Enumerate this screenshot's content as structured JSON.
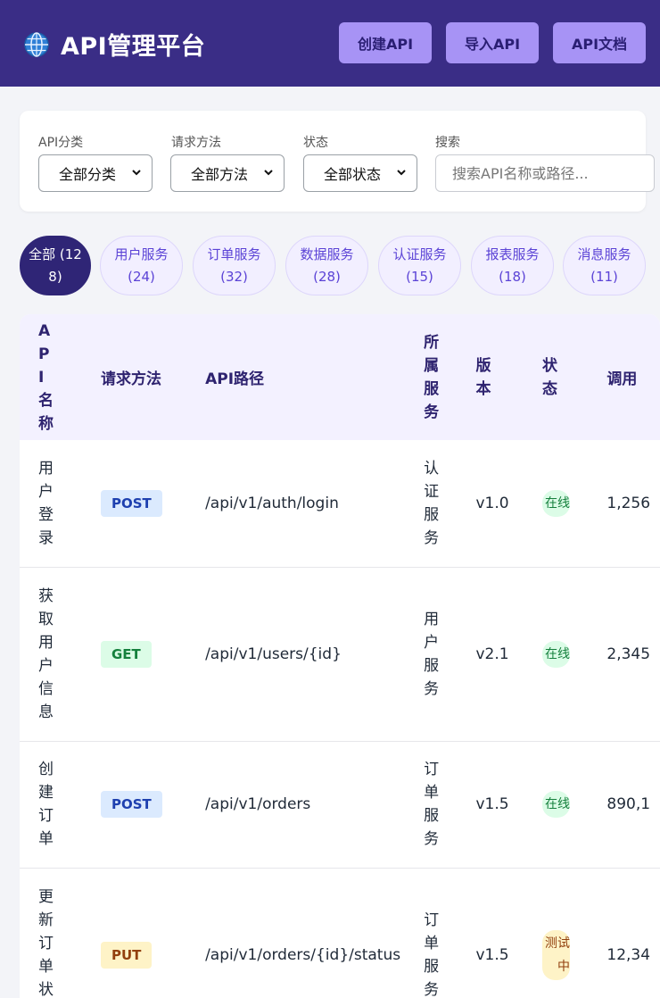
{
  "header": {
    "title": "API管理平台",
    "icon": "globe-icon",
    "buttons": [
      "创建API",
      "导入API",
      "API文档"
    ]
  },
  "filters": {
    "category": {
      "label": "API分类",
      "value": "全部分类"
    },
    "method": {
      "label": "请求方法",
      "value": "全部方法"
    },
    "status": {
      "label": "状态",
      "value": "全部状态"
    },
    "search": {
      "label": "搜索",
      "placeholder": "搜索API名称或路径..."
    }
  },
  "chips": [
    {
      "label": "全部 (128)",
      "active": true
    },
    {
      "label": "用户服务 (24)",
      "active": false
    },
    {
      "label": "订单服务 (32)",
      "active": false
    },
    {
      "label": "数据服务 (28)",
      "active": false
    },
    {
      "label": "认证服务 (15)",
      "active": false
    },
    {
      "label": "报表服务 (18)",
      "active": false
    },
    {
      "label": "消息服务 (11)",
      "active": false
    }
  ],
  "table": {
    "headers": {
      "name": "API名称",
      "method": "请求方法",
      "path": "API路径",
      "service": "所属服务",
      "version": "版本",
      "status": "状态",
      "calls": "调用"
    },
    "rows": [
      {
        "name": "用户登录",
        "method": "POST",
        "path": "/api/v1/auth/login",
        "service": "认证服务",
        "version": "v1.0",
        "status": "在线",
        "calls": "1,256"
      },
      {
        "name": "获取用户信息",
        "method": "GET",
        "path": "/api/v1/users/{id}",
        "service": "用户服务",
        "version": "v2.1",
        "status": "在线",
        "calls": "2,345"
      },
      {
        "name": "创建订单",
        "method": "POST",
        "path": "/api/v1/orders",
        "service": "订单服务",
        "version": "v1.5",
        "status": "在线",
        "calls": "890,1"
      },
      {
        "name": "更新订单状态",
        "method": "PUT",
        "path": "/api/v1/orders/{id}/status",
        "service": "订单服务",
        "version": "v1.5",
        "status": "测试中",
        "calls": "12,34"
      }
    ]
  },
  "colors": {
    "header_bg": "#3a2d86",
    "header_button": "#a793f5",
    "chip_active": "#2f2576",
    "post_bg": "#dbeafe",
    "get_bg": "#dcfce7",
    "put_bg": "#fef3c7",
    "status_online_bg": "#dcfce7",
    "status_testing_bg": "#fef3c7"
  }
}
